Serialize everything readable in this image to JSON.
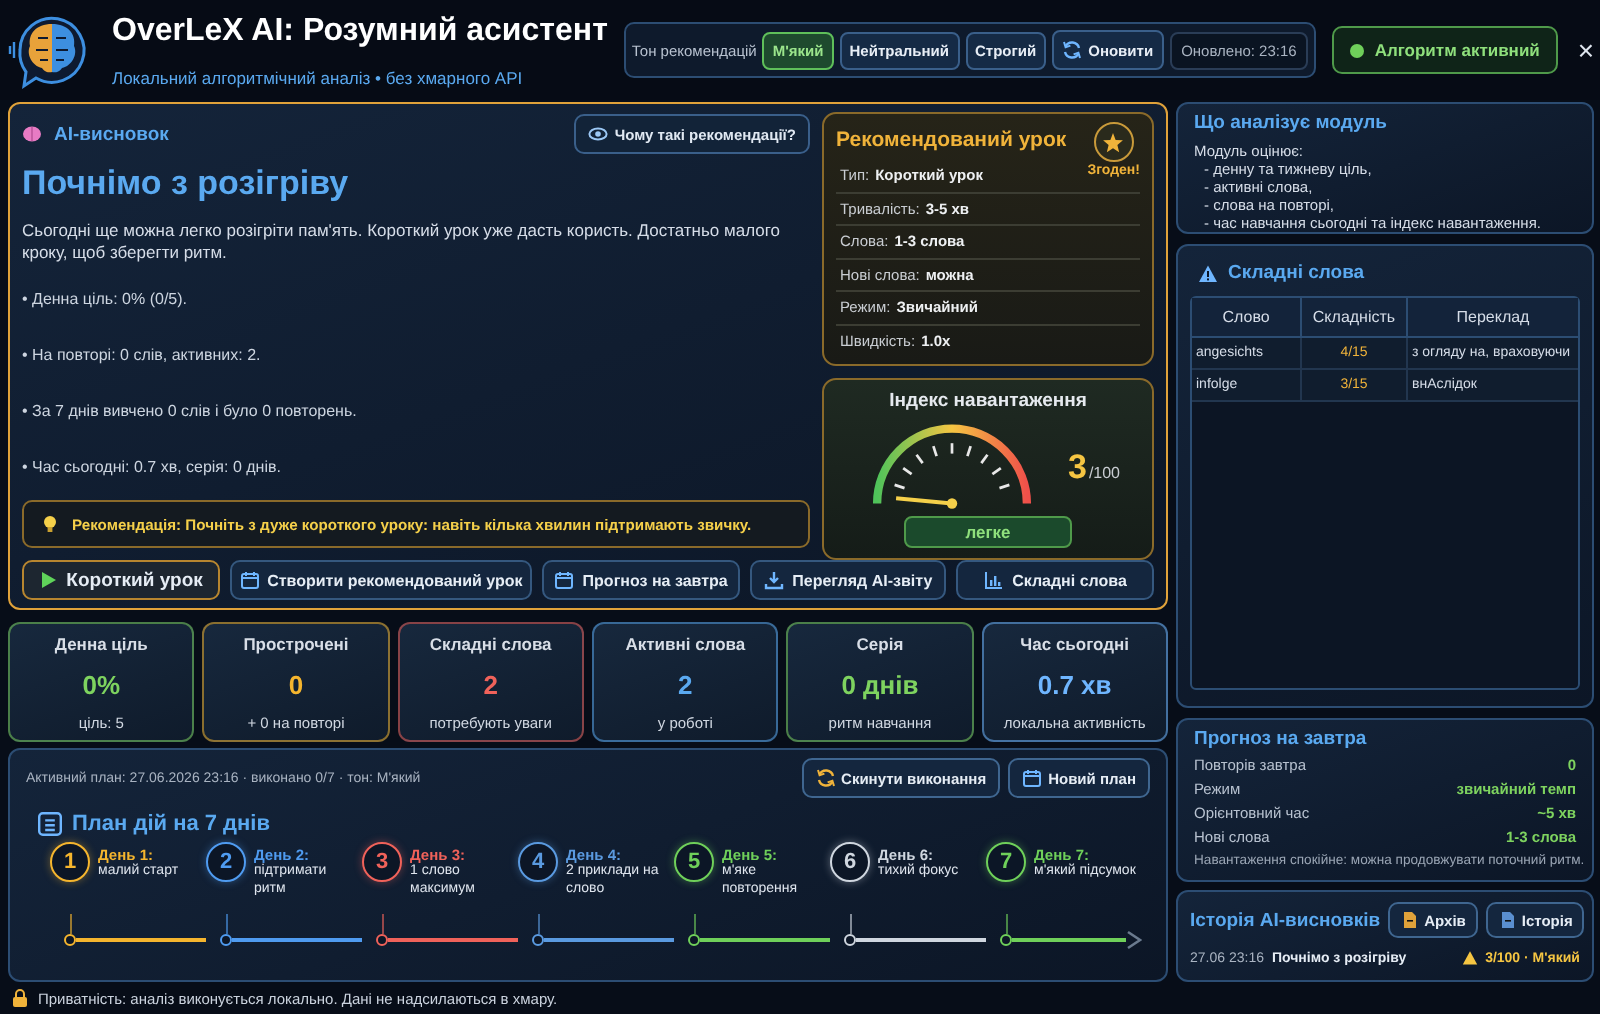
{
  "header": {
    "title": "OverLeX AI: Розумний асистент",
    "subtitle": "Локальний алгоритмічний аналіз • без хмарного API",
    "tone_label": "Тон рекомендацій",
    "tones": [
      {
        "label": "М'який",
        "selected": true
      },
      {
        "label": "Нейтральний",
        "selected": false
      },
      {
        "label": "Строгий",
        "selected": false
      }
    ],
    "refresh": "Оновити",
    "updated": "Оновлено: 23:16",
    "status": "Алгоритм активний",
    "close": "×"
  },
  "conclusion": {
    "heading": "AI-висновок",
    "why_button": "Чому такі рекомендації?",
    "title": "Почнімо з розігріву",
    "text": "Сьогодні ще можна легко розігріти пам'ять. Короткий урок уже дасть користь. Достатньо малого кроку, щоб зберегти ритм.",
    "bullets": [
      "• Денна ціль: 0% (0/5).",
      "• На повторі: 0 слів, активних: 2.",
      "• За 7 днів вивчено 0 слів і було 0 повторень.",
      "• Час сьогодні: 0.7 хв, серія: 0 днів."
    ],
    "recommendation": "Рекомендація: Почніть з дуже короткого уроку: навіть кілька хвилин підтримають звичку.",
    "actions": [
      {
        "label": "Короткий урок",
        "highlighted": true
      },
      {
        "label": "Створити рекомендований урок",
        "highlighted": false
      },
      {
        "label": "Прогноз на завтра",
        "highlighted": false
      },
      {
        "label": "Перегляд AI-звіту",
        "highlighted": false
      },
      {
        "label": "Складні слова",
        "highlighted": false
      }
    ]
  },
  "lesson": {
    "title": "Рекомендований урок",
    "badge": "Згоден!",
    "rows": [
      {
        "label": "Тип:",
        "value": "Короткий урок"
      },
      {
        "label": "Тривалість:",
        "value": "3-5 хв"
      },
      {
        "label": "Слова:",
        "value": "1-3 слова"
      },
      {
        "label": "Нові слова:",
        "value": "можна"
      },
      {
        "label": "Режим:",
        "value": "Звичайний"
      },
      {
        "label": "Швидкість:",
        "value": "1.0x"
      }
    ]
  },
  "load": {
    "title": "Індекс навантаження",
    "value": "3",
    "scale": "/100",
    "rating": "легке"
  },
  "analysis": {
    "title": "Що аналізує модуль",
    "intro": "Модуль оцінює:",
    "items": [
      "- денну та тижневу ціль,",
      "- активні слова,",
      "- слова на повторі,",
      "- час навчання сьогодні та індекс навантаження."
    ]
  },
  "hard_words": {
    "title": "Складні слова",
    "columns": [
      "Слово",
      "Складність",
      "Переклад"
    ],
    "rows": [
      [
        "angesichts",
        "4/15",
        "з огляду на, враховуючи"
      ],
      [
        "infolge",
        "3/15",
        "внАслідок"
      ]
    ]
  },
  "stats": [
    {
      "label": "Денна ціль",
      "value": "0%",
      "note": "ціль: 5",
      "color": "#7ed35f"
    },
    {
      "label": "Прострочені",
      "value": "0",
      "note": "+ 0 на повторі",
      "color": "#f5b52e"
    },
    {
      "label": "Складні слова",
      "value": "2",
      "note": "потребують уваги",
      "color": "#f0625a"
    },
    {
      "label": "Активні слова",
      "value": "2",
      "note": "у роботі",
      "color": "#5aa9f0"
    },
    {
      "label": "Серія",
      "value": "0 днів",
      "note": "ритм навчання",
      "color": "#7ed35f"
    },
    {
      "label": "Час сьогодні",
      "value": "0.7 хв",
      "note": "локальна активність",
      "color": "#6fb6ff"
    }
  ],
  "plan": {
    "meta": "Активний план: 27.06.2026 23:16 · виконано 0/7 · тон: М'який",
    "reset": "Скинути виконання",
    "new": "Новий план",
    "title": "План дій на 7 днів",
    "days": [
      {
        "number": "1",
        "title": "День 1:",
        "text": "малий старт",
        "color": "#f5b52e"
      },
      {
        "number": "2",
        "title": "День 2:",
        "text": "підтримати ритм",
        "color": "#4f9bf0"
      },
      {
        "number": "3",
        "title": "День 3:",
        "text": "1 слово максимум",
        "color": "#f0625a"
      },
      {
        "number": "4",
        "title": "День 4:",
        "text": "2 приклади на слово",
        "color": "#5a9ae0"
      },
      {
        "number": "5",
        "title": "День 5:",
        "text": "м'яке повторення",
        "color": "#6fd05a"
      },
      {
        "number": "6",
        "title": "День 6:",
        "text": "тихий фокус",
        "color": "#cfd6df"
      },
      {
        "number": "7",
        "title": "День 7:",
        "text": "м'який підсумок",
        "color": "#6fd05a"
      }
    ]
  },
  "forecast": {
    "title": "Прогноз на завтра",
    "rows": [
      {
        "label": "Повторів завтра",
        "value": "0"
      },
      {
        "label": "Режим",
        "value": "звичайний темп"
      },
      {
        "label": "Орієнтовний час",
        "value": "~5 хв"
      },
      {
        "label": "Нові слова",
        "value": "1-3 слова"
      }
    ],
    "note": "Навантаження спокійне: можна продовжувати поточний ритм."
  },
  "history": {
    "title": "Історія AI-висновків",
    "archive": "Архів",
    "history": "Історія",
    "entry": {
      "date": "27.06 23:16",
      "title": "Почнімо з розігріву",
      "result": "3/100 · М'який"
    }
  },
  "footer": "Приватність: аналіз виконується локально. Дані не надсилаються в хмару."
}
